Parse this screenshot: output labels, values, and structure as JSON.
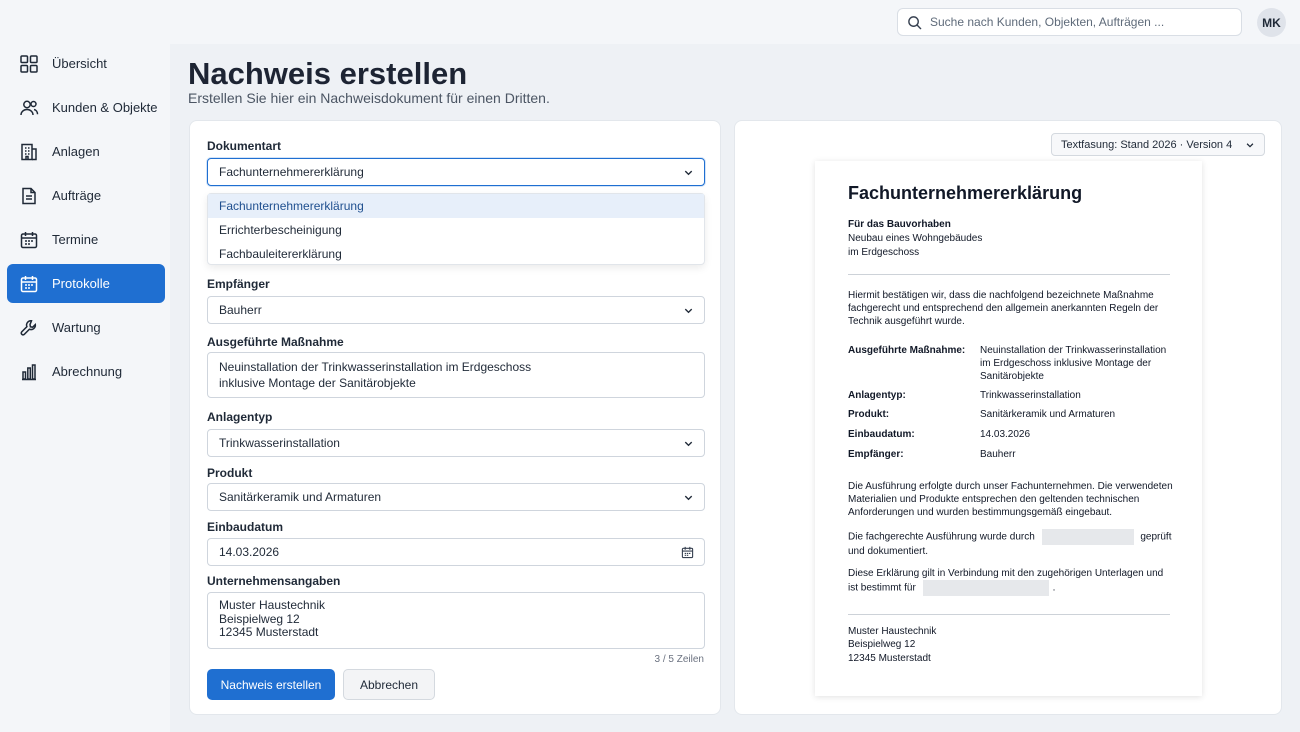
{
  "topbar": {
    "search_placeholder": "Suche nach Kunden, Objekten, Aufträgen ...",
    "avatar_initials": "MK"
  },
  "sidebar": {
    "items": [
      {
        "label": "Übersicht",
        "icon": "grid-icon",
        "active": false
      },
      {
        "label": "Kunden & Objekte",
        "icon": "users-icon",
        "active": false
      },
      {
        "label": "Anlagen",
        "icon": "building-icon",
        "active": false
      },
      {
        "label": "Aufträge",
        "icon": "document-icon",
        "active": false
      },
      {
        "label": "Termine",
        "icon": "calendar-icon",
        "active": false
      },
      {
        "label": "Protokolle",
        "icon": "clipboard-calendar-icon",
        "active": true
      },
      {
        "label": "Wartung",
        "icon": "wrench-icon",
        "active": false
      },
      {
        "label": "Abrechnung",
        "icon": "bar-chart-icon",
        "active": false
      }
    ]
  },
  "page": {
    "title": "Nachweis erstellen",
    "subtitle": "Erstellen Sie hier ein Nachweisdokument für einen Dritten."
  },
  "form": {
    "document_type": {
      "label": "Dokumentart",
      "value": "Fachunternehmererklärung",
      "options": [
        "Fachunternehmererklärung",
        "Errichterbescheinigung",
        "Fachbauleitererklärung"
      ]
    },
    "recipient": {
      "label": "Empfänger",
      "value": "Bauherr"
    },
    "measure": {
      "label": "Ausgeführte Maßnahme",
      "value": "Neuinstallation der Trinkwasserinstallation im Erdgeschoss\ninklusive Montage der Sanitärobjekte"
    },
    "system_type": {
      "label": "Anlagentyp",
      "value": "Trinkwasserinstallation"
    },
    "product": {
      "label": "Produkt",
      "value": "Sanitärkeramik und Armaturen"
    },
    "install_date": {
      "label": "Einbaudatum",
      "value": "14.03.2026"
    },
    "company": {
      "label": "Unternehmensangaben",
      "value": "Muster Haustechnik\nBeispielweg 12\n12345 Musterstadt",
      "line_count": "3 / 5 Zeilen"
    },
    "submit_label": "Nachweis erstellen",
    "cancel_label": "Abbrechen"
  },
  "preview": {
    "version_label": "Textfasung: Stand 2026 · Version 4",
    "doc_title": "Fachunternehmererklärung",
    "project_heading": "Für das Bauvorhaben",
    "project_line1": "Neubau eines Wohngebäudes",
    "project_line2": "im Erdgeschoss",
    "intro": "Hiermit bestätigen wir, dass die nachfolgend bezeichnete Maßnahme fachgerecht und entsprechend den allgemein anerkannten Regeln der Technik ausgeführt wurde.",
    "rows": [
      {
        "label": "Ausgeführte Maßnahme:",
        "value": "Neuinstallation der Trinkwasserinstallation im Erdgeschoss inklusive Montage der Sanitärobjekte"
      },
      {
        "label": "Anlagentyp:",
        "value": "Trinkwasserinstallation"
      },
      {
        "label": "Produkt:",
        "value": "Sanitärkeramik und Armaturen"
      },
      {
        "label": "Einbaudatum:",
        "value": "14.03.2026"
      },
      {
        "label": "Empfänger:",
        "value": "Bauherr"
      }
    ],
    "para1": "Die Ausführung erfolgte durch unser Fachunternehmen. Die verwendeten Materialien und Produkte entsprechen den geltenden technischen Anforderungen und wurden bestimmungsgemäß eingebaut.",
    "para2_a": "Die fachgerechte Ausführung wurde durch",
    "para2_b": "geprüft",
    "para2_c": "und dokumentiert.",
    "para3_a": "Diese Erklärung gilt in Verbindung mit den zugehörigen Unterlagen und",
    "para3_b": "ist bestimmt für",
    "para3_c": ".",
    "sig_line1": "Muster Haustechnik",
    "sig_line2": "Beispielweg 12",
    "sig_line3": "12345 Musterstadt"
  },
  "colors": {
    "accent": "#1f6fd1",
    "background": "#eef1f5"
  }
}
